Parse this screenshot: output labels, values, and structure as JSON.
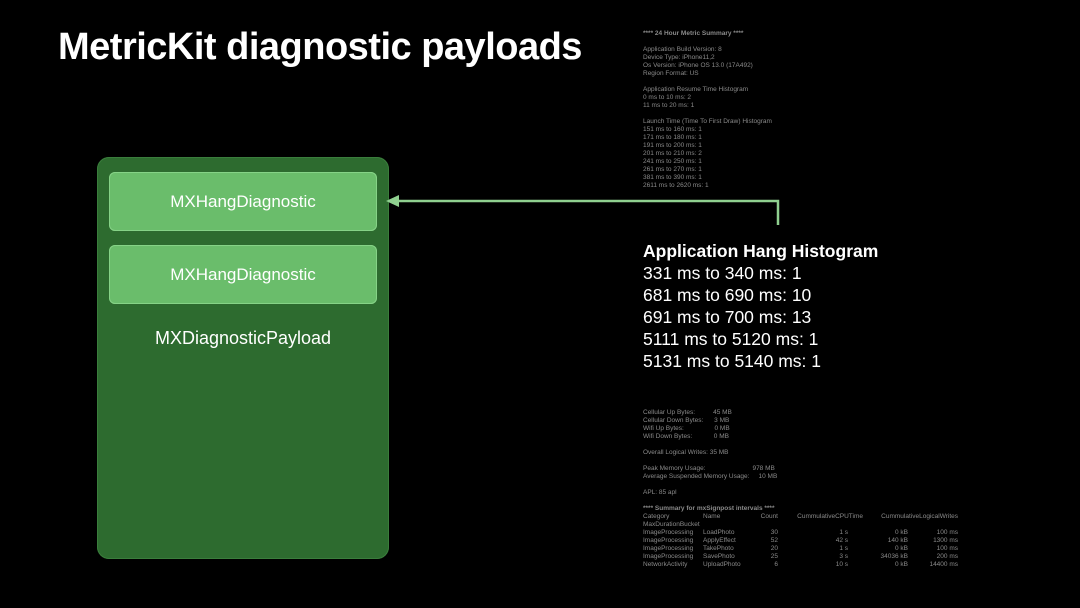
{
  "slide": {
    "title": "MetricKit diagnostic payloads"
  },
  "payload": {
    "items": [
      "MXHangDiagnostic",
      "MXHangDiagnostic"
    ],
    "label": "MXDiagnosticPayload"
  },
  "log_top": [
    "**** 24 Hour Metric Summary ****",
    "",
    "Application Build Version: 8",
    "Device Type: iPhone11,2",
    "Os Version: iPhone OS 13.0 (17A492)",
    "Region Format: US",
    "",
    "Application Resume Time Histogram",
    "0 ms to 10 ms: 2",
    "11 ms to 20 ms: 1",
    "",
    "Launch Time (Time To First Draw) Histogram",
    "151 ms to 160 ms: 1",
    "171 ms to 180 ms: 1",
    "191 ms to 200 ms: 1",
    "201 ms to 210 ms: 2",
    "241 ms to 250 ms: 1",
    "261 ms to 270 ms: 1",
    "381 ms to 390 ms: 1",
    "2611 ms to 2620 ms: 1"
  ],
  "histogram": {
    "title": "Application Hang Histogram",
    "rows": [
      "331 ms to 340 ms: 1",
      "681 ms to 690 ms: 10",
      "691 ms to 700 ms: 13",
      "5111 ms to 5120 ms: 1",
      "5131 ms to 5140 ms: 1"
    ]
  },
  "log_bottom": [
    "Cellular Up Bytes:          45 MB",
    "Cellular Down Bytes:      3 MB",
    "Wifi Up Bytes:                 0 MB",
    "Wifi Down Bytes:            0 MB",
    "",
    "Overall Logical Writes: 35 MB",
    "",
    "Peak Memory Usage:                          978 MB",
    "Average Suspended Memory Usage:     10 MB",
    "",
    "APL: 85 apl"
  ],
  "signpost": {
    "title": "**** Summary for mxSignpost intervals ****",
    "headers": [
      "Category",
      "Name",
      "Count",
      "CummulativeCPUTime",
      "CummulativeLogicalWrites",
      ""
    ],
    "subheader": "MaxDurationBucket",
    "rows": [
      [
        "ImageProcessing",
        "LoadPhoto",
        "30",
        "1 s",
        "0 kB",
        "100 ms"
      ],
      [
        "ImageProcessing",
        "ApplyEffect",
        "52",
        "42 s",
        "140 kB",
        "1300 ms"
      ],
      [
        "ImageProcessing",
        "TakePhoto",
        "20",
        "1 s",
        "0 kB",
        "100 ms"
      ],
      [
        "ImageProcessing",
        "SavePhoto",
        "25",
        "3 s",
        "34036 kB",
        "200 ms"
      ],
      [
        "NetworkActivity",
        "UploadPhoto",
        "6",
        "10 s",
        "0 kB",
        "14400 ms"
      ]
    ]
  },
  "colors": {
    "background": "#000000",
    "payload_fill": "#2d6b2f",
    "diagnostic_fill": "#6abd6b",
    "arrow": "#8fd08f"
  }
}
